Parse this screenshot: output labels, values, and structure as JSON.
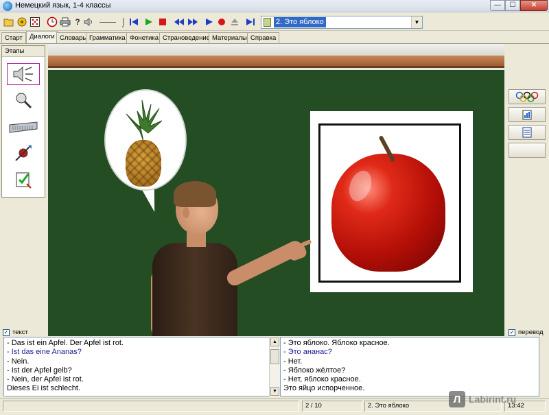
{
  "window": {
    "title": "Немецкий язык, 1-4 классы",
    "min_glyph": "—",
    "max_glyph": "☐",
    "close_glyph": "✕"
  },
  "toolbar": {
    "icons": [
      "folder-open-icon",
      "settings-icon",
      "dice-icon",
      "clock-icon",
      "print-icon",
      "help-icon",
      "sound-icon",
      "volume-slider-icon",
      "skip-start-icon",
      "play-icon",
      "stop-icon",
      "step-back-icon",
      "step-forward-icon",
      "play-alt-icon",
      "record-icon",
      "eject-icon",
      "skip-end-icon"
    ],
    "dialogue_select": {
      "value": "2. Это яблоко",
      "arrow": "▼"
    }
  },
  "tabs": [
    {
      "label": "Старт",
      "active": false
    },
    {
      "label": "Диалоги",
      "active": true
    },
    {
      "label": "Словарь",
      "active": false
    },
    {
      "label": "Грамматика",
      "active": false
    },
    {
      "label": "Фонетика",
      "active": false
    },
    {
      "label": "Страноведение",
      "active": false
    },
    {
      "label": "Материалы",
      "active": false
    },
    {
      "label": "Справка",
      "active": false
    }
  ],
  "stages": {
    "header": "Этапы",
    "items": [
      {
        "name": "listen-stage",
        "icon": "speaker-icon",
        "active": true
      },
      {
        "name": "speak-stage",
        "icon": "microphone-icon",
        "active": false
      },
      {
        "name": "keyboard-stage",
        "icon": "keyboard-icon",
        "active": false
      },
      {
        "name": "test-stage",
        "icon": "dart-icon",
        "active": false
      },
      {
        "name": "check-stage",
        "icon": "clipboard-icon",
        "active": false
      }
    ]
  },
  "right_panel": {
    "buttons": [
      "olympic-rings-icon",
      "stats-icon",
      "document-icon",
      "blank-button"
    ]
  },
  "checkboxes": {
    "text_label": "текст",
    "text_checked": "✓",
    "translation_label": "перевод",
    "translation_checked": "✓"
  },
  "dialogue_german": [
    {
      "text": "- Das ist ein Apfel. Der Apfel ist rot.",
      "highlight": false
    },
    {
      "text": "- Ist das eine Ananas?",
      "highlight": true
    },
    {
      "text": "- Nein.",
      "highlight": false
    },
    {
      "text": "- Ist der Apfel gelb?",
      "highlight": false
    },
    {
      "text": "- Nein, der Apfel ist rot.",
      "highlight": false
    },
    {
      "text": "Dieses Ei ist schlecht.",
      "highlight": false
    }
  ],
  "dialogue_russian": [
    {
      "text": "- Это яблоко. Яблоко красное.",
      "highlight": false
    },
    {
      "text": "- Это ананас?",
      "highlight": true
    },
    {
      "text": "- Нет.",
      "highlight": false
    },
    {
      "text": "- Яблоко жёлтое?",
      "highlight": false
    },
    {
      "text": "- Нет, яблоко красное.",
      "highlight": false
    },
    {
      "text": "Это яйцо испорченное.",
      "highlight": false
    }
  ],
  "status": {
    "page": "2 / 10",
    "lesson": "2. Это яблоко",
    "time": "13:42"
  },
  "watermark": {
    "mark": "Л",
    "text": "Labirint.ru"
  },
  "colors": {
    "board": "#244d24",
    "highlight_text": "#1a1a9a",
    "select_highlight": "#316ac5"
  }
}
